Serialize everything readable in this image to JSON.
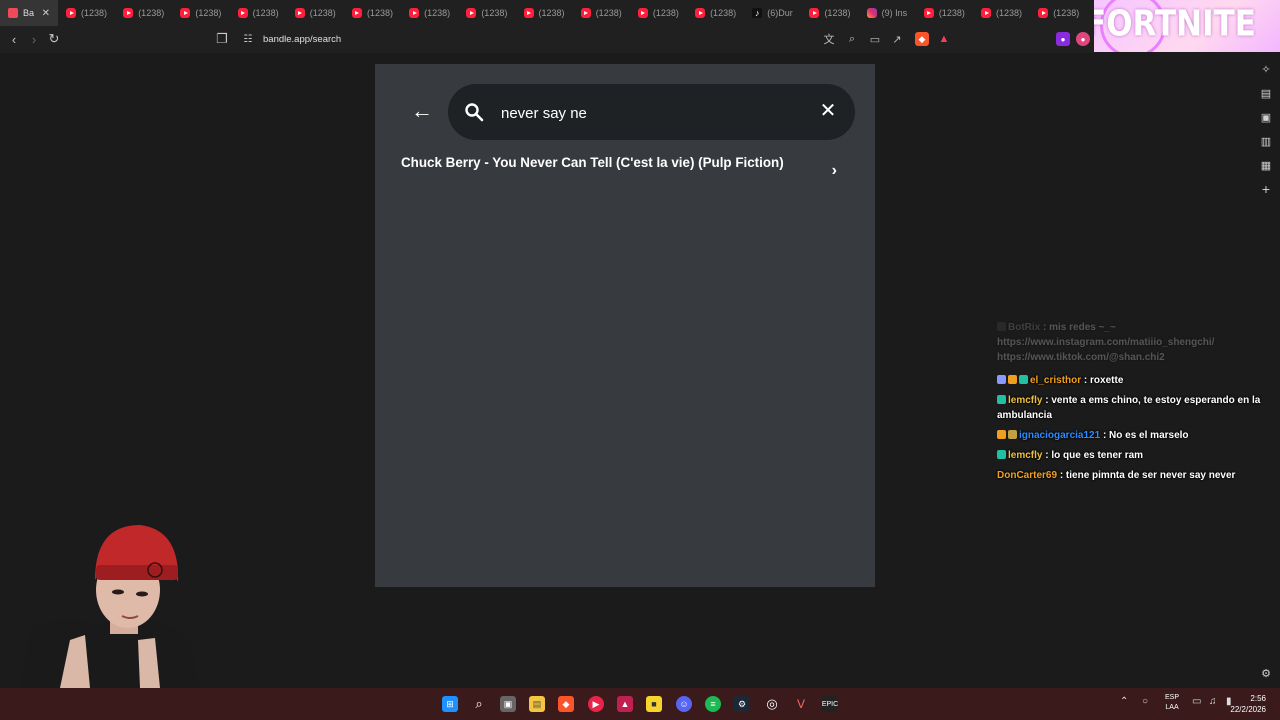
{
  "tabs": [
    {
      "label": "Ba",
      "icon": "bandle-favicon",
      "active": true
    },
    {
      "label": "(1238)",
      "icon": "youtube-favicon"
    },
    {
      "label": "(1238)",
      "icon": "youtube-favicon"
    },
    {
      "label": "(1238)",
      "icon": "youtube-favicon"
    },
    {
      "label": "(1238)",
      "icon": "youtube-favicon"
    },
    {
      "label": "(1238)",
      "icon": "youtube-favicon"
    },
    {
      "label": "(1238)",
      "icon": "youtube-favicon"
    },
    {
      "label": "(1238)",
      "icon": "youtube-favicon"
    },
    {
      "label": "(1238)",
      "icon": "youtube-favicon"
    },
    {
      "label": "(1238)",
      "icon": "youtube-favicon"
    },
    {
      "label": "(1238)",
      "icon": "youtube-favicon"
    },
    {
      "label": "(1238)",
      "icon": "youtube-favicon"
    },
    {
      "label": "(1238)",
      "icon": "youtube-favicon"
    },
    {
      "label": "(6)Dur",
      "icon": "tiktok-favicon"
    },
    {
      "label": "(1238)",
      "icon": "youtube-favicon"
    },
    {
      "label": "(9) Ins",
      "icon": "instagram-favicon"
    },
    {
      "label": "(1238)",
      "icon": "youtube-favicon"
    },
    {
      "label": "(1238)",
      "icon": "youtube-favicon"
    },
    {
      "label": "(1238)",
      "icon": "youtube-favicon"
    }
  ],
  "banner": {
    "text": "FORTNITE"
  },
  "address_bar": {
    "url": "bandle.app/search"
  },
  "search": {
    "query": "never say ne"
  },
  "results": [
    {
      "title": "Chuck Berry - You Never Can Tell (C'est la vie) (Pulp Fiction)"
    }
  ],
  "chat": [
    {
      "user": "BotRix",
      "text": ": mis redes ~_~ https://www.instagram.com/matiiio_shengchi/ https://www.tiktok.com/@shan.chi2",
      "user_color": "#aaaaaa",
      "faded": true
    },
    {
      "user": "el_cristhor",
      "text": ": roxette",
      "user_color": "#f0a020"
    },
    {
      "user": "lemcfly",
      "text": ": vente a ems chino, te estoy esperando en la ambulancia",
      "user_color": "#f0c040"
    },
    {
      "user": "ignaciogarcia121",
      "text": ": No es el marselo",
      "user_color": "#2d8cff"
    },
    {
      "user": "lemcfly",
      "text": ": lo que es tener ram",
      "user_color": "#f0c040"
    },
    {
      "user": "DonCarter69",
      "text": ": tiene pimnta de ser never say never",
      "user_color": "#f0a020"
    }
  ],
  "taskbar": {
    "lang_top": "ESP",
    "lang_bottom": "LAA",
    "time": "2:56",
    "date": "22/2/2026"
  },
  "colors": {
    "game_bg": "#373b3f",
    "search_bg": "#1f2225",
    "taskbar_bg": "#3a1a1a"
  }
}
